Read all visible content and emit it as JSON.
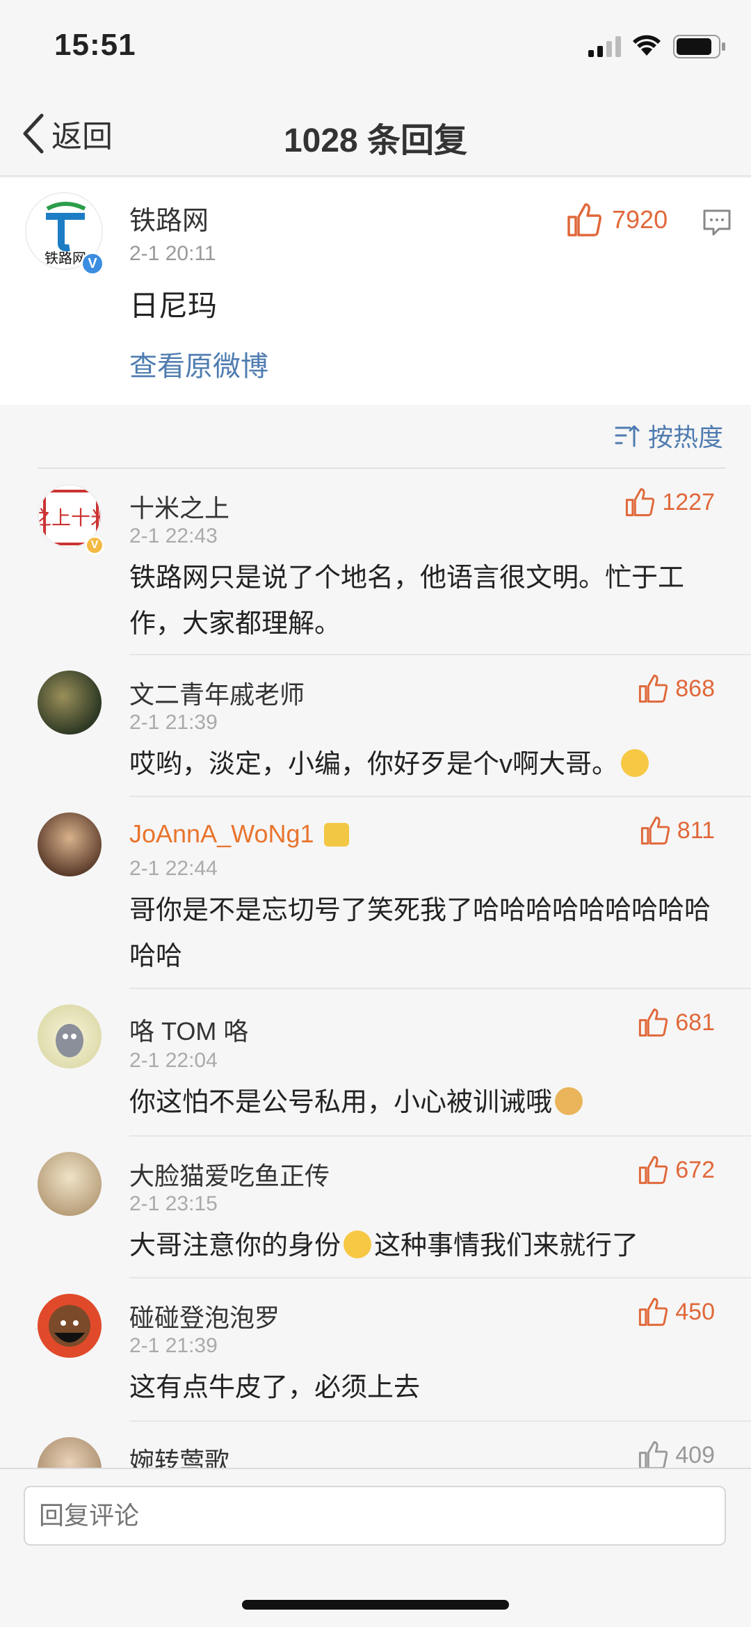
{
  "status_bar": {
    "time": "15:51"
  },
  "nav": {
    "back_label": "返回",
    "title": "1028 条回复"
  },
  "post": {
    "name": "铁路网",
    "time": "2-1 20:11",
    "content": "日尼玛",
    "likes": "7920",
    "view_original": "查看原微博",
    "avatar_text": "铁路网"
  },
  "sort": {
    "label": "按热度"
  },
  "comments": [
    {
      "name": "十米之上",
      "time": "2-1 22:43",
      "likes": "1227",
      "text": "铁路网只是说了个地名，他语言很文明。忙于工作，大家都理解。",
      "avatar_text": "之上十米"
    },
    {
      "name": "文二青年戚老师",
      "time": "2-1 21:39",
      "likes": "868",
      "text": "哎哟，淡定，小编，你好歹是个v啊大哥。"
    },
    {
      "name": "JoAnnA_WoNg1",
      "time": "2-1 22:44",
      "likes": "811",
      "text": "哥你是不是忘切号了笑死我了哈哈哈哈哈哈哈哈哈哈哈"
    },
    {
      "name": "咯 TOM 咯",
      "time": "2-1 22:04",
      "likes": "681",
      "text": "你这怕不是公号私用，小心被训诫哦"
    },
    {
      "name": "大脸猫爱吃鱼正传",
      "time": "2-1 23:15",
      "likes": "672",
      "text_a": "大哥注意你的身份",
      "text_b": "这种事情我们来就行了"
    },
    {
      "name": "碰碰登泡泡罗",
      "time": "2-1 21:39",
      "likes": "450",
      "text": "这有点牛皮了，必须上去"
    },
    {
      "name": "婉转莺歌",
      "likes": "409"
    }
  ],
  "reply_box": {
    "placeholder": "回复评论"
  },
  "colors": {
    "accent_like": "#e0683a",
    "link_blue": "#4f7cb0",
    "vip_orange": "#e8742d"
  }
}
